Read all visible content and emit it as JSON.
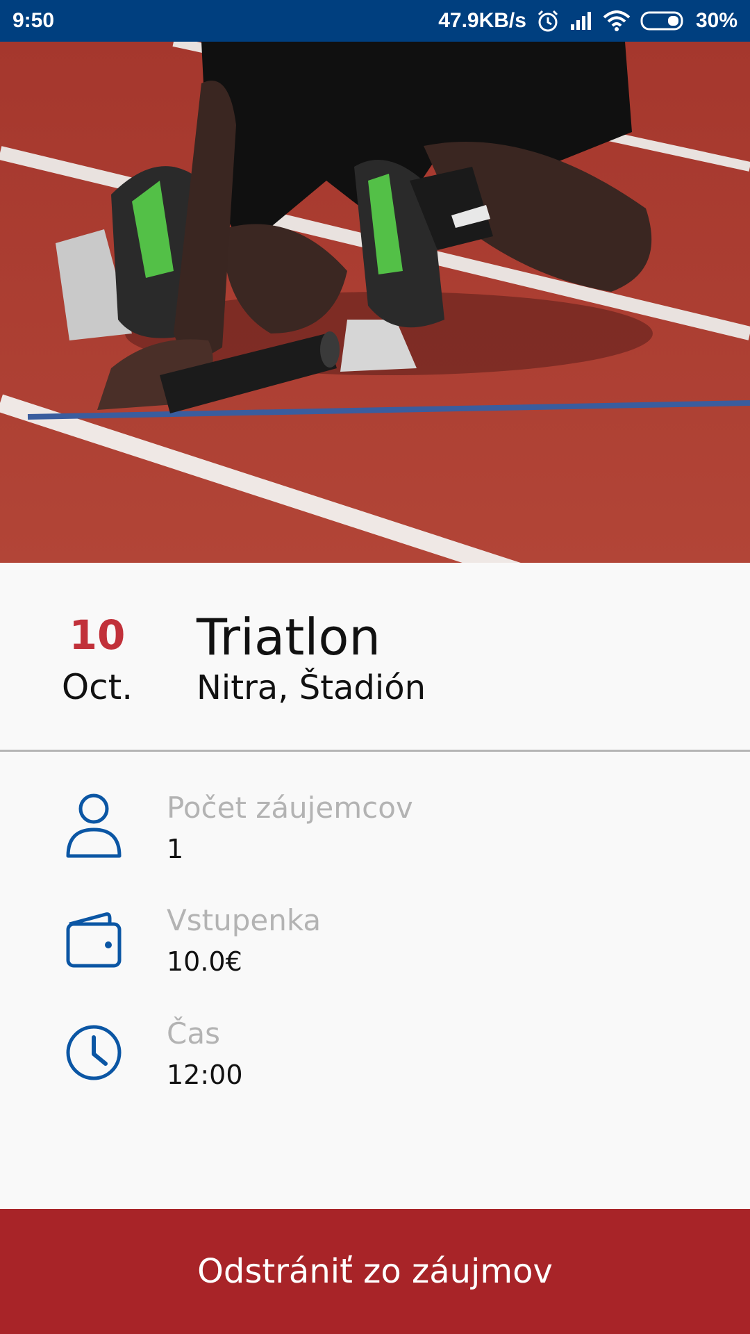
{
  "status_bar": {
    "time": "9:50",
    "network_speed": "47.9KB/s",
    "battery": "30%",
    "icons": [
      "alarm-icon",
      "signal-icon",
      "wifi-icon",
      "battery-icon"
    ]
  },
  "hero": {
    "image": "runner-starting-blocks-photo"
  },
  "event": {
    "day": "10",
    "month": "Oct.",
    "title": "Triatlon",
    "location": "Nitra, Štadión"
  },
  "details": [
    {
      "icon": "person-icon",
      "label": "Počet záujemcov",
      "value": "1"
    },
    {
      "icon": "wallet-icon",
      "label": "Vstupenka",
      "value": "10.0€"
    },
    {
      "icon": "clock-icon",
      "label": "Čas",
      "value": "12:00"
    }
  ],
  "action": {
    "label": "Odstrániť zo záujmov"
  },
  "colors": {
    "status_bar": "#003f7f",
    "accent_red": "#c1313a",
    "button_red": "#a82428",
    "icon_blue": "#0b56a4",
    "label_gray": "#b3b3b3"
  }
}
